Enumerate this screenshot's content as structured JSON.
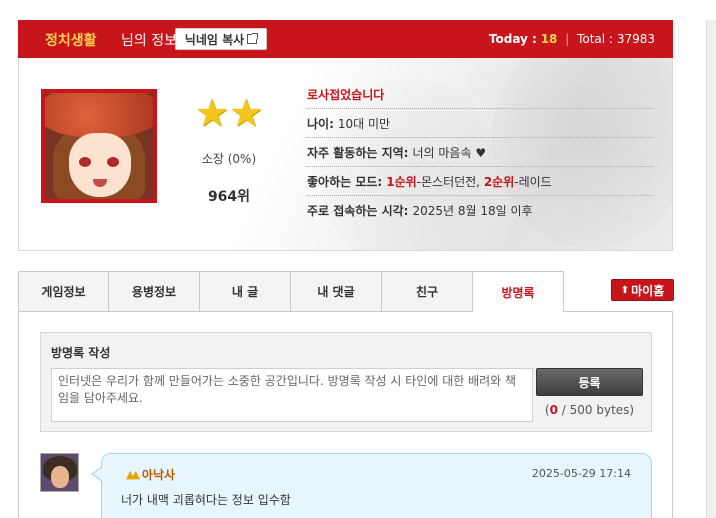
{
  "header": {
    "nickname": "정치생활",
    "nickname_suffix": "님의 정보",
    "copy_button": "닉네임 복사",
    "today_label": "Today :",
    "today_value": "18",
    "separator": "|",
    "total_label": "Total :",
    "total_value": "37983"
  },
  "profile": {
    "stars": "★★",
    "possession": "소장 (0%)",
    "rank": "964위",
    "greeting": "로사접었습니다",
    "age_label": "나이:",
    "age_value": "10대 미만",
    "area_label": "자주 활동하는 지역:",
    "area_value": "너의 마음속 ♥",
    "mode_label": "좋아하는 모드:",
    "mode_rank1": "1순위",
    "mode_value1": "-몬스터던전, ",
    "mode_rank2": "2순위",
    "mode_value2": "-레이드",
    "time_label": "주로 접속하는 시각:",
    "time_value": "2025년 8월 18일 이후"
  },
  "tabs": [
    {
      "label": "게임정보"
    },
    {
      "label": "용병정보"
    },
    {
      "label": "내 글"
    },
    {
      "label": "내 댓글"
    },
    {
      "label": "친구"
    },
    {
      "label": "방명록"
    }
  ],
  "myhome": {
    "icon": "⬆",
    "label": "마이홈"
  },
  "guestbook": {
    "title": "방명록 작성",
    "placeholder": "인터넷은 우리가 함께 만들어가는 소중한 공간입니다. 방명록 작성 시 타인에 대한 배려와 책임을 담아주세요.",
    "submit": "등록",
    "bytes_open": "(",
    "bytes_current": "0",
    "bytes_max": " / 500 bytes)"
  },
  "entries": [
    {
      "writer": "아낙사",
      "date": "2025-05-29 17:14",
      "message": "너가 내맥 괴롭혀다는 정보 입수함"
    }
  ],
  "colors": {
    "brand": "#c8151b",
    "accent": "#ffd34d",
    "bubble": "#e7f6fd"
  }
}
